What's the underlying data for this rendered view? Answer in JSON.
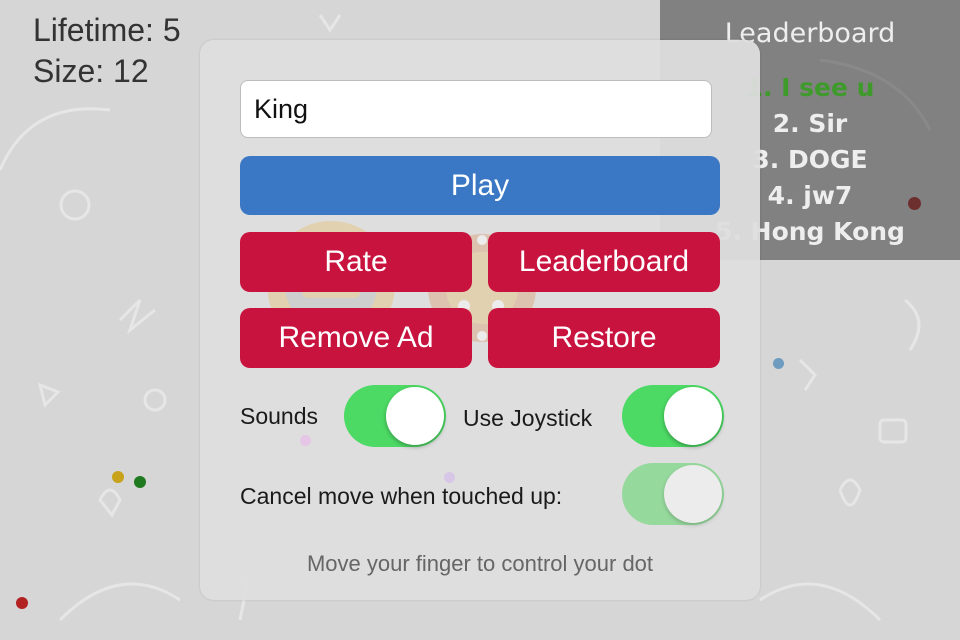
{
  "hud": {
    "lifetime": "Lifetime: 5",
    "size": "Size: 12"
  },
  "leaderboard": {
    "title": "Leaderboard",
    "entries": [
      "1. I see u",
      "2. Sir",
      "3. DOGE",
      "4. jw7",
      "5. Hong Kong"
    ],
    "highlight_color": "#3f9a2c"
  },
  "menu": {
    "name_input_value": "King",
    "play_label": "Play",
    "rate_label": "Rate",
    "leaderboard_label": "Leaderboard",
    "remove_ad_label": "Remove Ad",
    "restore_label": "Restore",
    "sounds_label": "Sounds",
    "sounds_on": true,
    "joystick_label": "Use Joystick",
    "joystick_on": true,
    "cancel_move_label": "Cancel move when touched up:",
    "cancel_move_on": true,
    "cancel_move_enabled": false,
    "hint": "Move your finger to control your dot"
  },
  "colors": {
    "play_button": "#3a77c4",
    "red_button": "#c8133f",
    "toggle_on": "#4cd964"
  }
}
